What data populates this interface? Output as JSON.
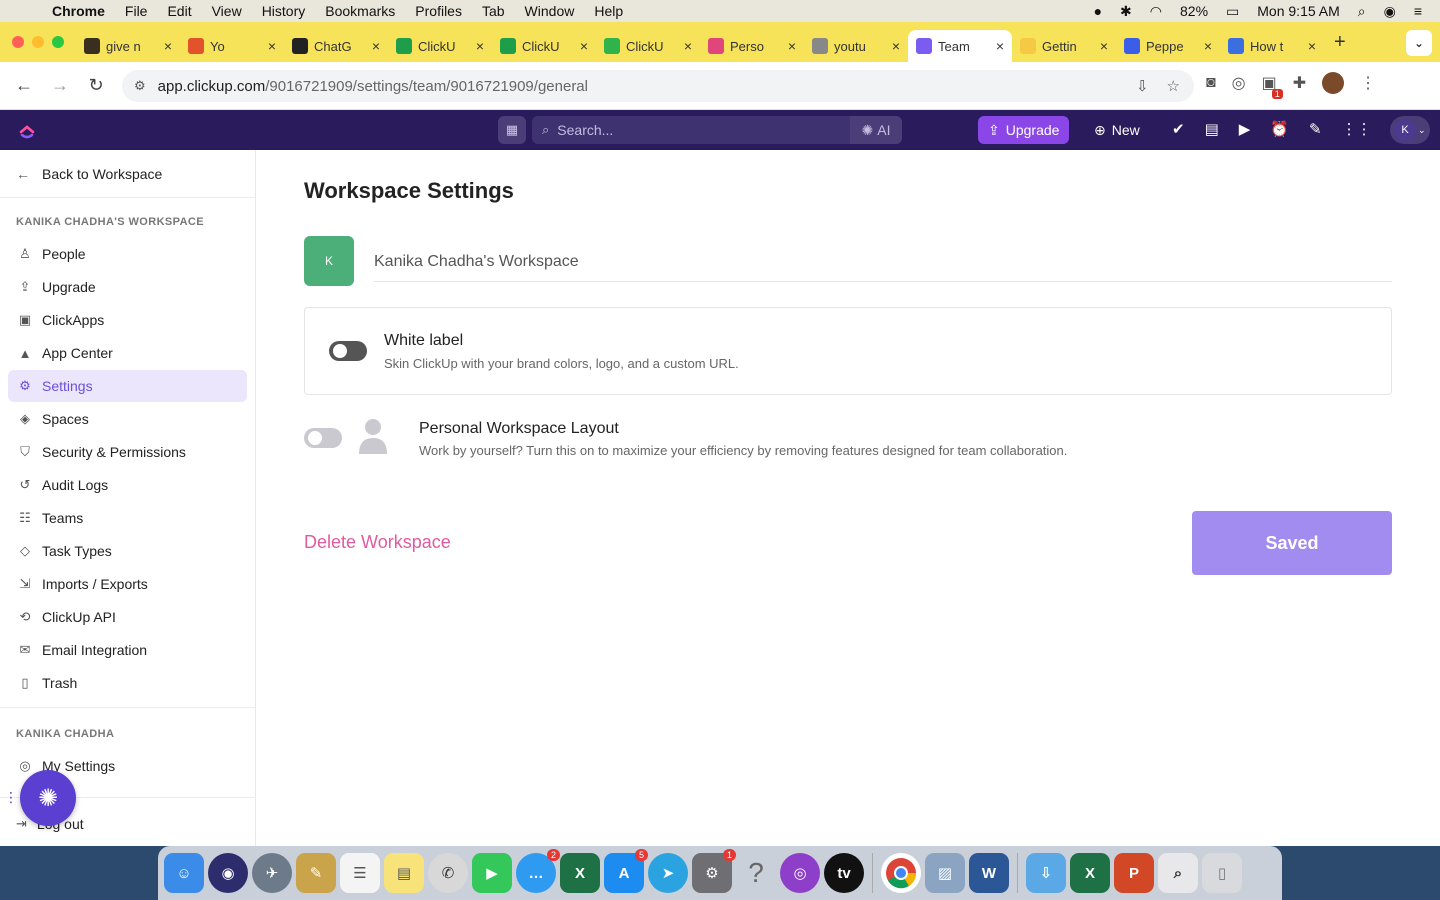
{
  "menubar": {
    "app": "Chrome",
    "items": [
      "File",
      "Edit",
      "View",
      "History",
      "Bookmarks",
      "Profiles",
      "Tab",
      "Window",
      "Help"
    ],
    "battery": "82%",
    "clock": "Mon 9:15 AM"
  },
  "tabs": [
    {
      "title": "give n",
      "fav_color": "#3a2f1f"
    },
    {
      "title": "Yo",
      "fav_color": "#e2522b"
    },
    {
      "title": "ChatG",
      "fav_color": "#222222"
    },
    {
      "title": "ClickU",
      "fav_color": "#1e9e4a"
    },
    {
      "title": "ClickU",
      "fav_color": "#1e9e4a"
    },
    {
      "title": "ClickU",
      "fav_color": "#2fb34a"
    },
    {
      "title": "Perso",
      "fav_color": "#e0467c"
    },
    {
      "title": "youtu",
      "fav_color": "#888888"
    },
    {
      "title": "Team",
      "fav_color": "#7b5cf0"
    },
    {
      "title": "Gettin",
      "fav_color": "#f6c944"
    },
    {
      "title": "Peppe",
      "fav_color": "#3b5ee8"
    },
    {
      "title": "How t",
      "fav_color": "#3b6fe0"
    }
  ],
  "address": {
    "domain": "app.clickup.com",
    "path": "/9016721909/settings/team/9016721909/general"
  },
  "extensions": {
    "badge_count": "1"
  },
  "topbar": {
    "search_placeholder": "Search...",
    "ai_label": "AI",
    "upgrade_label": "Upgrade",
    "new_label": "New",
    "user_initial": "K"
  },
  "sidebar": {
    "back_label": "Back to Workspace",
    "workspace_header": "KANIKA CHADHA'S WORKSPACE",
    "items": [
      {
        "label": "People",
        "icon": "person-icon"
      },
      {
        "label": "Upgrade",
        "icon": "upgrade-icon"
      },
      {
        "label": "ClickApps",
        "icon": "clickapps-icon"
      },
      {
        "label": "App Center",
        "icon": "app-center-icon"
      },
      {
        "label": "Settings",
        "icon": "gear-icon"
      },
      {
        "label": "Spaces",
        "icon": "spaces-icon"
      },
      {
        "label": "Security & Permissions",
        "icon": "shield-icon"
      },
      {
        "label": "Audit Logs",
        "icon": "history-icon"
      },
      {
        "label": "Teams",
        "icon": "teams-icon"
      },
      {
        "label": "Task Types",
        "icon": "cube-icon"
      },
      {
        "label": "Imports / Exports",
        "icon": "import-icon"
      },
      {
        "label": "ClickUp API",
        "icon": "api-icon"
      },
      {
        "label": "Email Integration",
        "icon": "mail-icon"
      },
      {
        "label": "Trash",
        "icon": "trash-icon"
      }
    ],
    "active_index": 4,
    "user_header": "KANIKA CHADHA",
    "my_settings_label": "My Settings",
    "logout_label": "Log out"
  },
  "main": {
    "title": "Workspace Settings",
    "avatar_initial": "K",
    "workspace_name": "Kanika Chadha's Workspace",
    "white_label": {
      "title": "White label",
      "description": "Skin ClickUp with your brand colors, logo, and a custom URL.",
      "enabled": false
    },
    "personal_layout": {
      "title": "Personal Workspace Layout",
      "description": "Work by yourself? Turn this on to maximize your efficiency by removing features designed for team collaboration.",
      "enabled": false
    },
    "delete_label": "Delete Workspace",
    "saved_label": "Saved"
  },
  "dock": {
    "messages_badge": "2",
    "appstore_badge": "5",
    "settings_badge": "1",
    "excel_letter": "X",
    "word_letter": "W",
    "ppt_letter": "P",
    "help_glyph": "?",
    "appletv_label": "tv"
  },
  "colors": {
    "accent": "#7b5cf0",
    "topbar": "#2a1b5c",
    "delete": "#e05b9f",
    "saved_button": "#a38cf0",
    "workspace_avatar": "#4caf7a"
  }
}
